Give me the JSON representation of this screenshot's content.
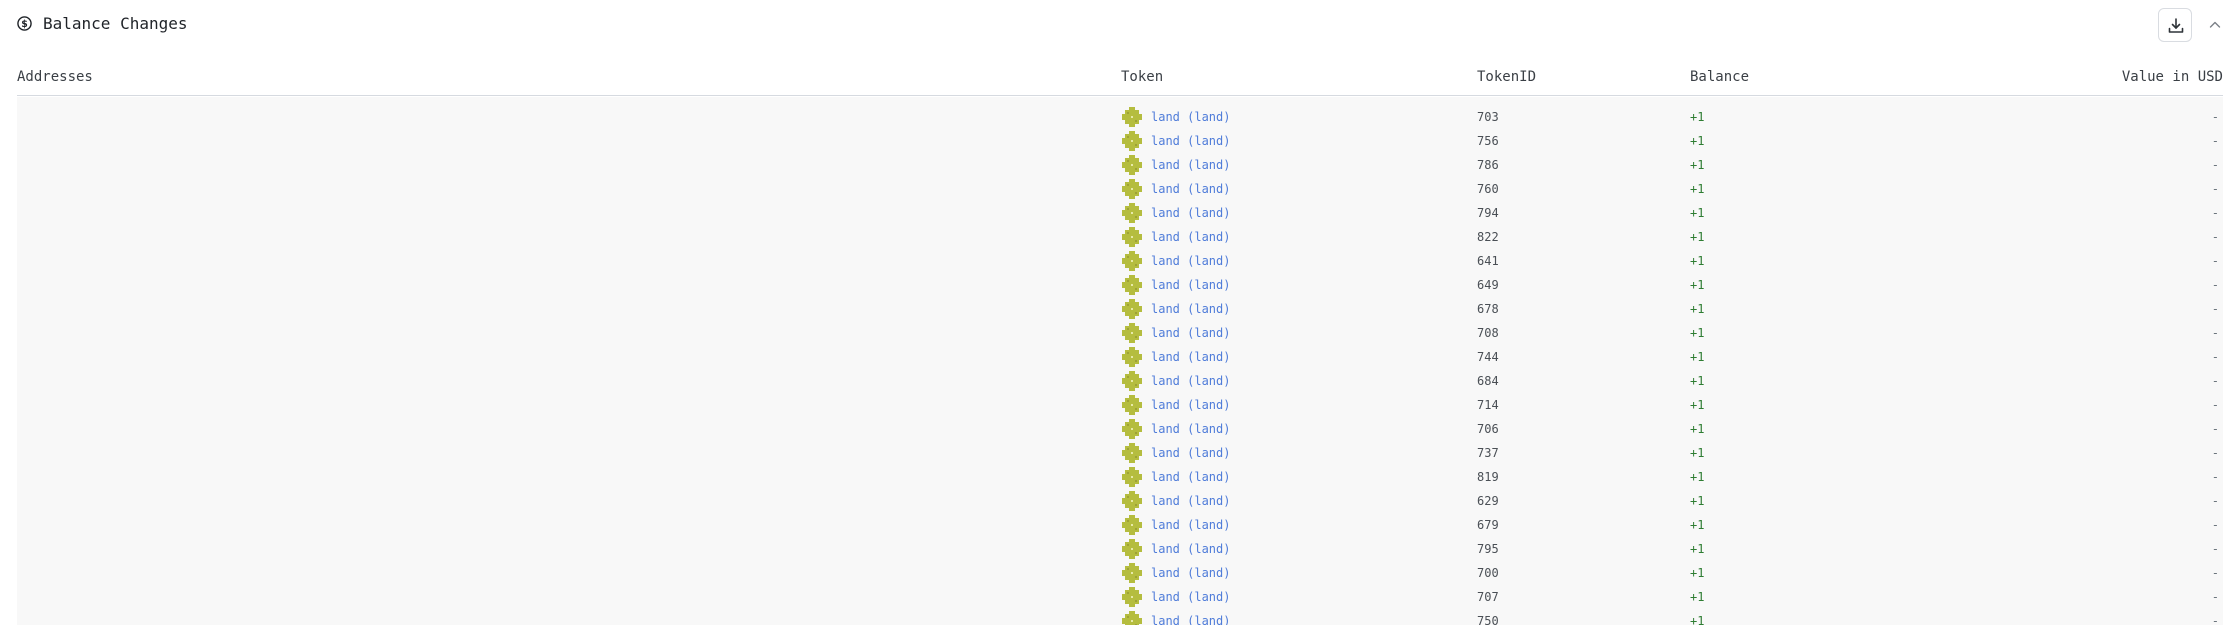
{
  "header": {
    "title": "Balance Changes",
    "title_icon": "dollar-circle-icon",
    "download_icon": "download-icon",
    "collapse_icon": "chevron-up-icon"
  },
  "table": {
    "columns": {
      "addresses": "Addresses",
      "token": "Token",
      "token_id": "TokenID",
      "balance": "Balance",
      "value_usd": "Value in USD"
    },
    "rows": [
      {
        "token": "land (land)",
        "token_id": "703",
        "balance": "+1",
        "value": "-"
      },
      {
        "token": "land (land)",
        "token_id": "756",
        "balance": "+1",
        "value": "-"
      },
      {
        "token": "land (land)",
        "token_id": "786",
        "balance": "+1",
        "value": "-"
      },
      {
        "token": "land (land)",
        "token_id": "760",
        "balance": "+1",
        "value": "-"
      },
      {
        "token": "land (land)",
        "token_id": "794",
        "balance": "+1",
        "value": "-"
      },
      {
        "token": "land (land)",
        "token_id": "822",
        "balance": "+1",
        "value": "-"
      },
      {
        "token": "land (land)",
        "token_id": "641",
        "balance": "+1",
        "value": "-"
      },
      {
        "token": "land (land)",
        "token_id": "649",
        "balance": "+1",
        "value": "-"
      },
      {
        "token": "land (land)",
        "token_id": "678",
        "balance": "+1",
        "value": "-"
      },
      {
        "token": "land (land)",
        "token_id": "708",
        "balance": "+1",
        "value": "-"
      },
      {
        "token": "land (land)",
        "token_id": "744",
        "balance": "+1",
        "value": "-"
      },
      {
        "token": "land (land)",
        "token_id": "684",
        "balance": "+1",
        "value": "-"
      },
      {
        "token": "land (land)",
        "token_id": "714",
        "balance": "+1",
        "value": "-"
      },
      {
        "token": "land (land)",
        "token_id": "706",
        "balance": "+1",
        "value": "-"
      },
      {
        "token": "land (land)",
        "token_id": "737",
        "balance": "+1",
        "value": "-"
      },
      {
        "token": "land (land)",
        "token_id": "819",
        "balance": "+1",
        "value": "-"
      },
      {
        "token": "land (land)",
        "token_id": "629",
        "balance": "+1",
        "value": "-"
      },
      {
        "token": "land (land)",
        "token_id": "679",
        "balance": "+1",
        "value": "-"
      },
      {
        "token": "land (land)",
        "token_id": "795",
        "balance": "+1",
        "value": "-"
      },
      {
        "token": "land (land)",
        "token_id": "700",
        "balance": "+1",
        "value": "-"
      },
      {
        "token": "land (land)",
        "token_id": "707",
        "balance": "+1",
        "value": "-"
      },
      {
        "token": "land (land)",
        "token_id": "750",
        "balance": "+1",
        "value": "-"
      }
    ]
  },
  "colors": {
    "token_link": "#4f7cd9",
    "balance_positive": "#2e7d32",
    "token_icon": "#b5bd3f",
    "body_bg": "#f8f8f8"
  },
  "token_icon_name": "land-token-icon"
}
